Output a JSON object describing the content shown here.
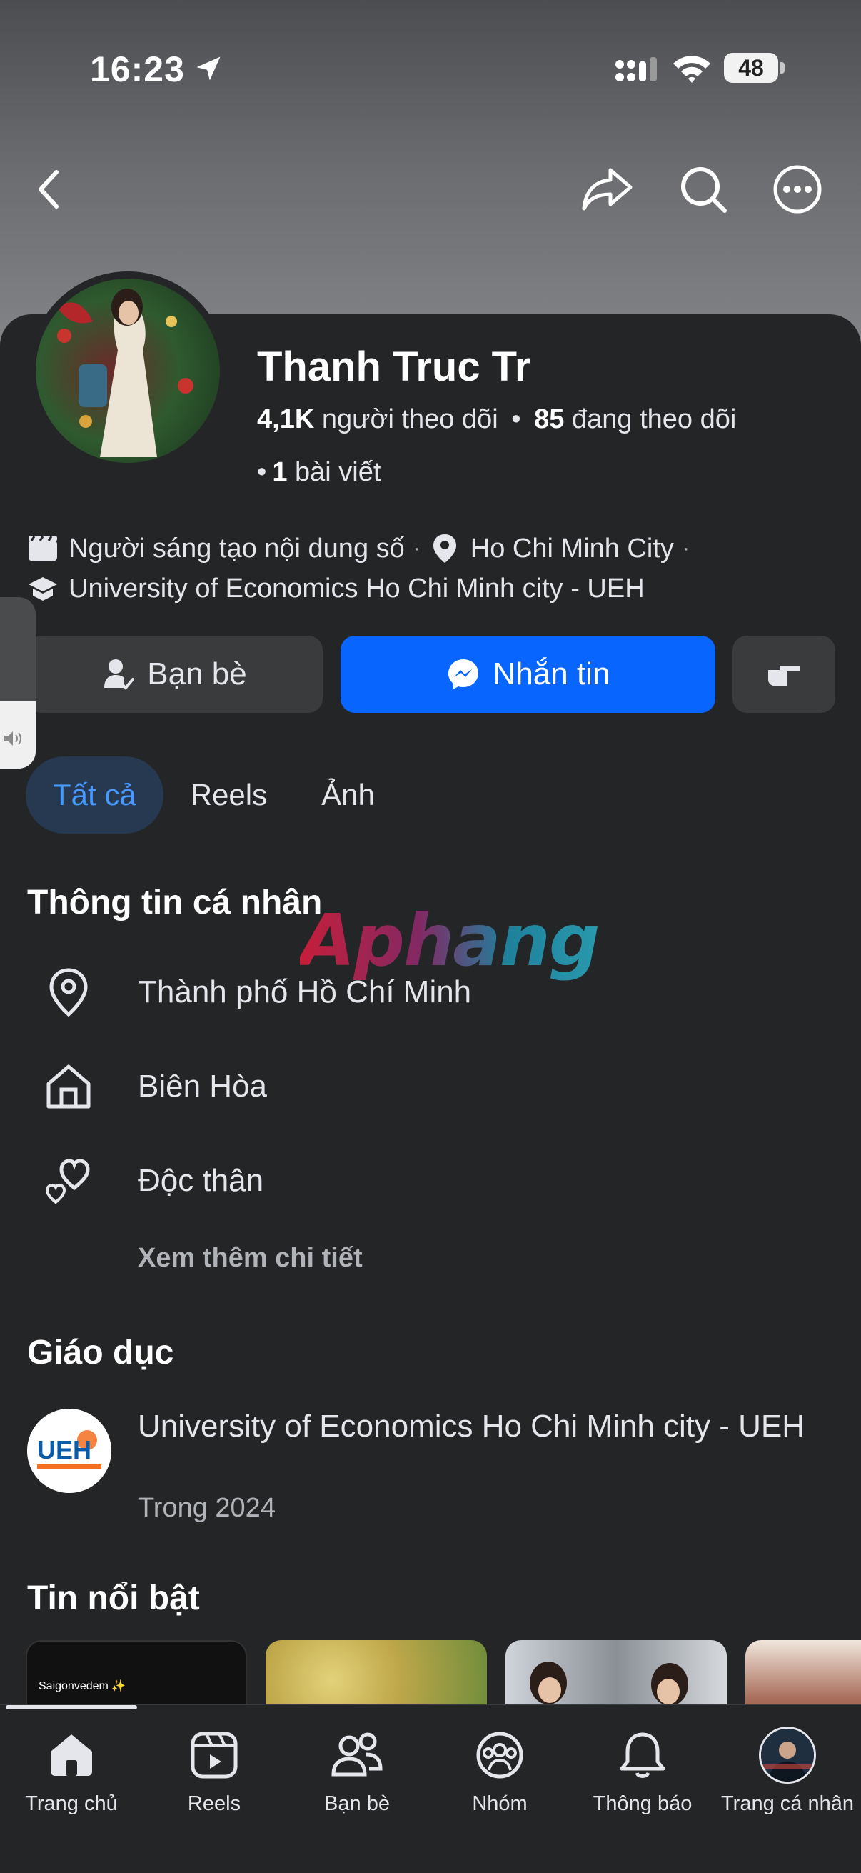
{
  "status_bar": {
    "time": "16:23",
    "battery": "48"
  },
  "profile": {
    "name": "Thanh Truc Tr",
    "followers_count": "4,1K",
    "followers_label": "người theo dõi",
    "following_count": "85",
    "following_label": "đang theo dõi",
    "posts_count": "1",
    "posts_label": "bài viết",
    "category": "Người sáng tạo nội dung số",
    "location": "Ho Chi Minh City",
    "school": "University of Economics Ho Chi Minh city - UEH"
  },
  "actions": {
    "friends": "Bạn bè",
    "message": "Nhắn tin"
  },
  "tabs": [
    {
      "label": "Tất cả",
      "active": true
    },
    {
      "label": "Reels",
      "active": false
    },
    {
      "label": "Ảnh",
      "active": false
    }
  ],
  "personal_info": {
    "title": "Thông tin cá nhân",
    "items": [
      {
        "icon": "location-pin-icon",
        "text": "Thành phố Hồ Chí Minh"
      },
      {
        "icon": "home-icon",
        "text": "Biên Hòa"
      },
      {
        "icon": "hearts-icon",
        "text": "Độc thân"
      }
    ],
    "see_more": "Xem thêm chi tiết"
  },
  "watermark": "Aphang",
  "education": {
    "title": "Giáo dục",
    "school": "University of Economics Ho Chi Minh city - UEH",
    "period": "Trong 2024",
    "logo_text": "UEH"
  },
  "highlights": {
    "title": "Tin nổi bật",
    "first_label": "Saigonvedem ✨"
  },
  "bottom_nav": [
    {
      "label": "Trang chủ",
      "icon": "home-icon"
    },
    {
      "label": "Reels",
      "icon": "reels-icon"
    },
    {
      "label": "Bạn bè",
      "icon": "friends-icon"
    },
    {
      "label": "Nhóm",
      "icon": "groups-icon"
    },
    {
      "label": "Thông báo",
      "icon": "bell-icon"
    },
    {
      "label": "Trang cá nhân",
      "icon": "profile-avatar"
    }
  ],
  "colors": {
    "background": "#242526",
    "accent": "#0866ff",
    "active_tab_bg": "#263951",
    "active_tab_text": "#4599ff"
  }
}
